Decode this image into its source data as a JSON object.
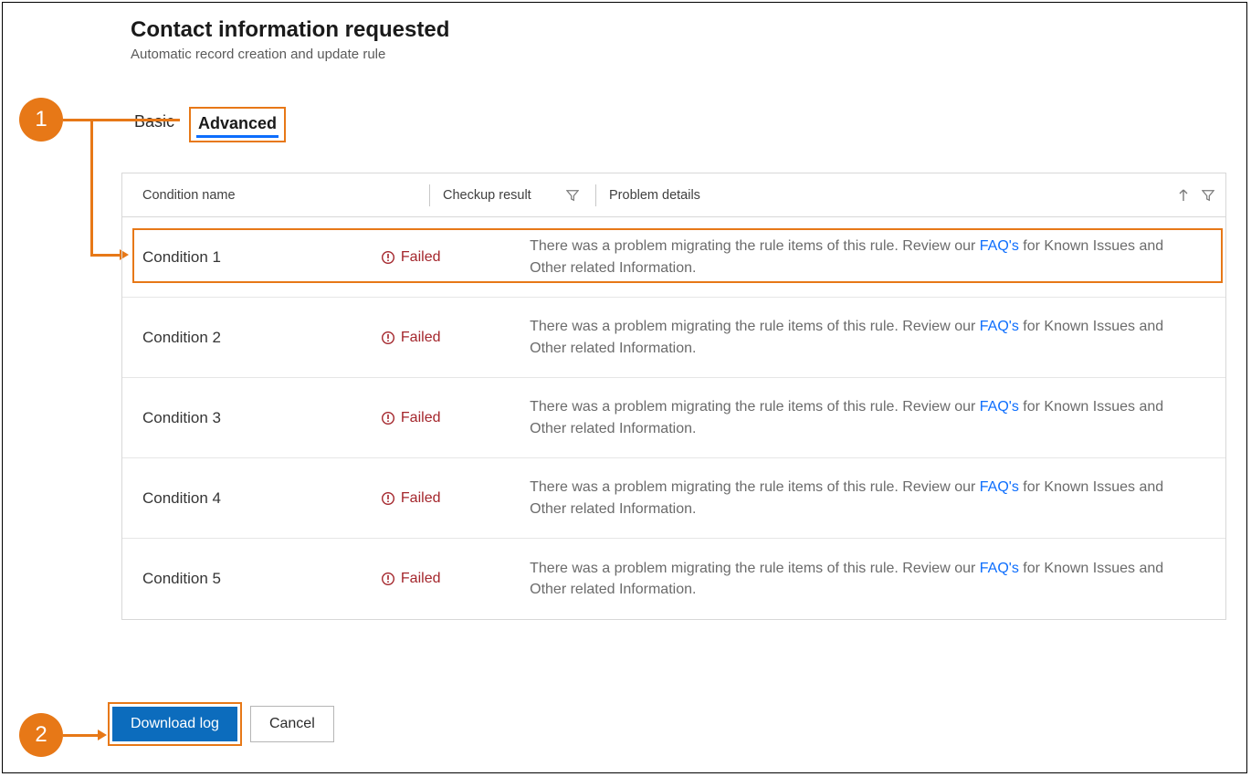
{
  "header": {
    "title": "Contact information requested",
    "subtitle": "Automatic record creation and update rule"
  },
  "tabs": {
    "basic": "Basic",
    "advanced": "Advanced"
  },
  "callouts": {
    "c1": "1",
    "c2": "2"
  },
  "table": {
    "col_condition": "Condition name",
    "col_result": "Checkup result",
    "col_details": "Problem details",
    "failed_label": "Failed",
    "detail_prefix": "There was a problem migrating the rule items of this rule. Review our ",
    "detail_link": "FAQ's",
    "detail_suffix": " for Known Issues and Other related Information.",
    "rows": [
      {
        "name": "Condition 1"
      },
      {
        "name": "Condition 2"
      },
      {
        "name": "Condition 3"
      },
      {
        "name": "Condition 4"
      },
      {
        "name": "Condition 5"
      }
    ]
  },
  "buttons": {
    "download": "Download log",
    "cancel": "Cancel"
  }
}
